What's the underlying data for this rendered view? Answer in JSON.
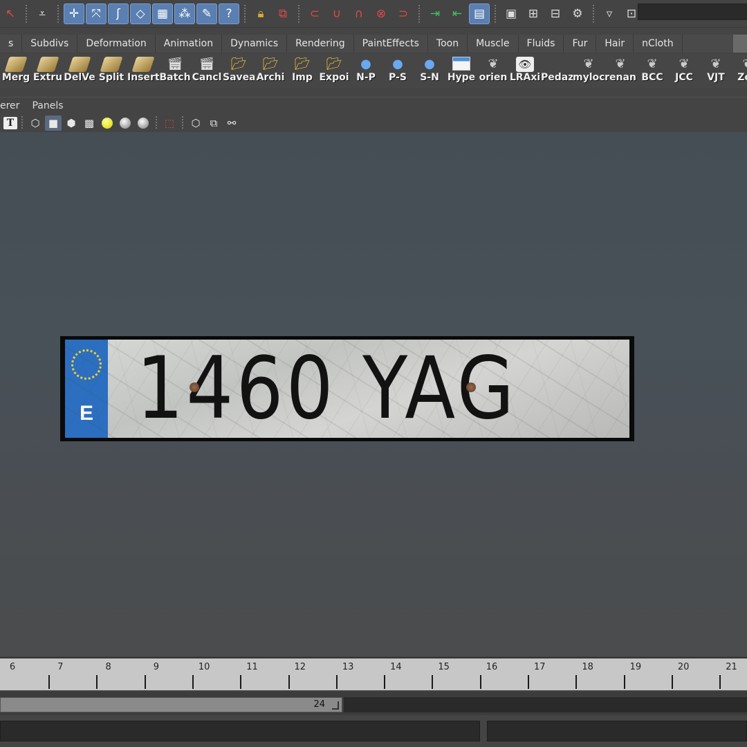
{
  "status_line": {
    "icons": [
      "select-tool-icon",
      "hierarchy-icon",
      "snap-grid-icon",
      "snap-curve-icon",
      "snap-point-icon",
      "snap-surface-icon",
      "snap-view-icon",
      "snap-live-icon",
      "help-icon",
      "lock-icon",
      "history-icon",
      "construction-history-icon",
      "magnet-icon",
      "magnet-icon",
      "magnet-icon",
      "magnet-icon",
      "input-ops-icon",
      "output-ops-icon",
      "attribute-editor-icon",
      "render-view-icon",
      "render-icon",
      "ipr-render-icon",
      "render-settings-icon",
      "collapse-icon",
      "quick-select-icon"
    ],
    "search_value": ""
  },
  "shelf_tabs": [
    "s",
    "Subdivs",
    "Deformation",
    "Animation",
    "Dynamics",
    "Rendering",
    "PaintEffects",
    "Toon",
    "Muscle",
    "Fluids",
    "Fur",
    "Hair",
    "nCloth"
  ],
  "shelf_buttons": [
    {
      "label": "Merg",
      "icon": "merge-icon",
      "style": "poly"
    },
    {
      "label": "Extru",
      "icon": "extrude-icon",
      "style": "poly"
    },
    {
      "label": "DelVe",
      "icon": "delete-vertex-icon",
      "style": "poly"
    },
    {
      "label": "Split",
      "icon": "split-icon",
      "style": "poly"
    },
    {
      "label": "Insert",
      "icon": "insert-edge-icon",
      "style": "poly"
    },
    {
      "label": "Batch",
      "icon": "clapboard-icon",
      "style": "clap"
    },
    {
      "label": "Cancl",
      "icon": "clapboard-icon",
      "style": "clap"
    },
    {
      "label": "Savea",
      "icon": "folder-icon",
      "style": "folder"
    },
    {
      "label": "Archi",
      "icon": "folder-icon",
      "style": "folder"
    },
    {
      "label": "Imp",
      "icon": "folder-icon",
      "style": "folder"
    },
    {
      "label": "Expoi",
      "icon": "folder-icon",
      "style": "folder"
    },
    {
      "label": "N-P",
      "icon": "sphere-icon",
      "style": "globe"
    },
    {
      "label": "P-S",
      "icon": "sphere-icon",
      "style": "globe"
    },
    {
      "label": "S-N",
      "icon": "sphere-icon",
      "style": "globe"
    },
    {
      "label": "Hype",
      "icon": "window-icon",
      "style": "win"
    },
    {
      "label": "orien",
      "icon": "mel-icon",
      "style": "glyph"
    },
    {
      "label": "LRAxi",
      "icon": "eye-icon",
      "style": "eye"
    },
    {
      "label": "Pedaz",
      "icon": "blank-icon",
      "style": "blank"
    },
    {
      "label": "myloc",
      "icon": "mel-icon",
      "style": "glyph"
    },
    {
      "label": "renan",
      "icon": "mel-icon",
      "style": "glyph"
    },
    {
      "label": "BCC",
      "icon": "mel-icon",
      "style": "glyph"
    },
    {
      "label": "JCC",
      "icon": "mel-icon",
      "style": "glyph"
    },
    {
      "label": "VJT",
      "icon": "mel-icon",
      "style": "glyph"
    },
    {
      "label": "Zoo",
      "icon": "mel-icon",
      "style": "glyph"
    }
  ],
  "panel_menu": [
    "erer",
    "Panels"
  ],
  "plate": {
    "country_code": "E",
    "number": "1460 YAG"
  },
  "timeline": {
    "ticks": [
      "6",
      "7",
      "8",
      "9",
      "10",
      "11",
      "12",
      "13",
      "14",
      "15",
      "16",
      "17",
      "18",
      "19",
      "20",
      "21"
    ]
  },
  "range": {
    "end_frame": "24"
  },
  "command_line": {
    "value": ""
  }
}
